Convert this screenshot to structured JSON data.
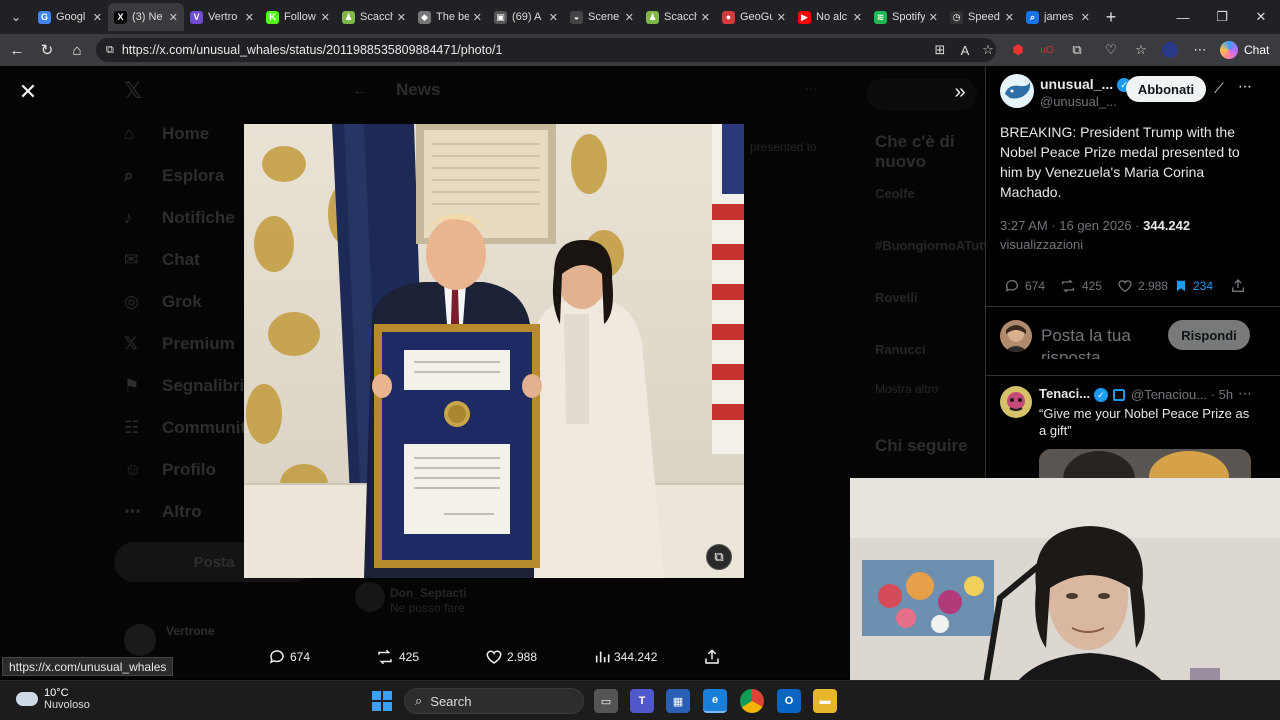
{
  "browser": {
    "tabs": [
      {
        "title": "Googl",
        "color": "#4285f4",
        "glyph": "G"
      },
      {
        "title": "(3) Ne",
        "color": "#000000",
        "glyph": "X",
        "active": true
      },
      {
        "title": "Vertro",
        "color": "#6f4bd8",
        "glyph": "V"
      },
      {
        "title": "Follow",
        "color": "#53fc18",
        "glyph": "K"
      },
      {
        "title": "Scacch",
        "color": "#81b64c",
        "glyph": "♟"
      },
      {
        "title": "The be",
        "color": "#777777",
        "glyph": "◆"
      },
      {
        "title": "(69) A",
        "color": "#555555",
        "glyph": "▣"
      },
      {
        "title": "Scene",
        "color": "#444444",
        "glyph": "◒"
      },
      {
        "title": "Scacch",
        "color": "#81b64c",
        "glyph": "♟"
      },
      {
        "title": "GeoGu",
        "color": "#d23b3b",
        "glyph": "●"
      },
      {
        "title": "No alc",
        "color": "#ff0000",
        "glyph": "▶"
      },
      {
        "title": "Spotify",
        "color": "#1db954",
        "glyph": "≋"
      },
      {
        "title": "Speed",
        "color": "#333333",
        "glyph": "◷"
      },
      {
        "title": "james",
        "color": "#1a73e8",
        "glyph": "⌕"
      }
    ],
    "url": "https://x.com/unusual_whales/status/2011988535809884471/photo/1",
    "chat_label": "Chat",
    "status_url": "https://x.com/unusual_whales"
  },
  "background_app": {
    "nav": [
      "Home",
      "Esplora",
      "Notifiche",
      "Chat",
      "Grok",
      "Premium",
      "Segnalibri",
      "Community",
      "Profilo",
      "Altro"
    ],
    "post_button": "Posta",
    "header": "News",
    "trends_title": "Che c'è di nuovo",
    "trends": [
      "Ceolfe",
      "#BuongiornoATutt",
      "Rovelli",
      "Ranucci"
    ],
    "trend_more": "Mostra altro",
    "follow_title": "Chi seguire",
    "account_name": "Vertrone",
    "reply_author": "Don_Septacti",
    "reply_text": "Ne posso fare",
    "presented_to": "presented to"
  },
  "viewer": {
    "actions": {
      "replies": "674",
      "reposts": "425",
      "likes": "2.988",
      "views": "344.242"
    }
  },
  "tweet": {
    "author_name": "unusual_...",
    "author_handle": "@unusual_...",
    "subscribe_label": "Abbonati",
    "text": "BREAKING: President Trump with the Nobel Peace Prize medal presented to him by Venezuela's Maria Corina Machado.",
    "time": "3:27 AM · 16 gen 2026 ·",
    "views_count": "344.242",
    "views_label": "visualizzazioni",
    "replies": "674",
    "reposts": "425",
    "likes": "2.988",
    "bookmarks": "234"
  },
  "reply_box": {
    "placeholder": "Posta la tua risposta",
    "button": "Rispondi"
  },
  "reply": {
    "author_name": "Tenaci...",
    "author_handle": "@Tenaciou...",
    "age": "· 5h",
    "text": "“Give me your Nobel Peace Prize as a gift”"
  },
  "taskbar": {
    "temperature": "10°C",
    "weather": "Nuvoloso",
    "search": "Search"
  }
}
